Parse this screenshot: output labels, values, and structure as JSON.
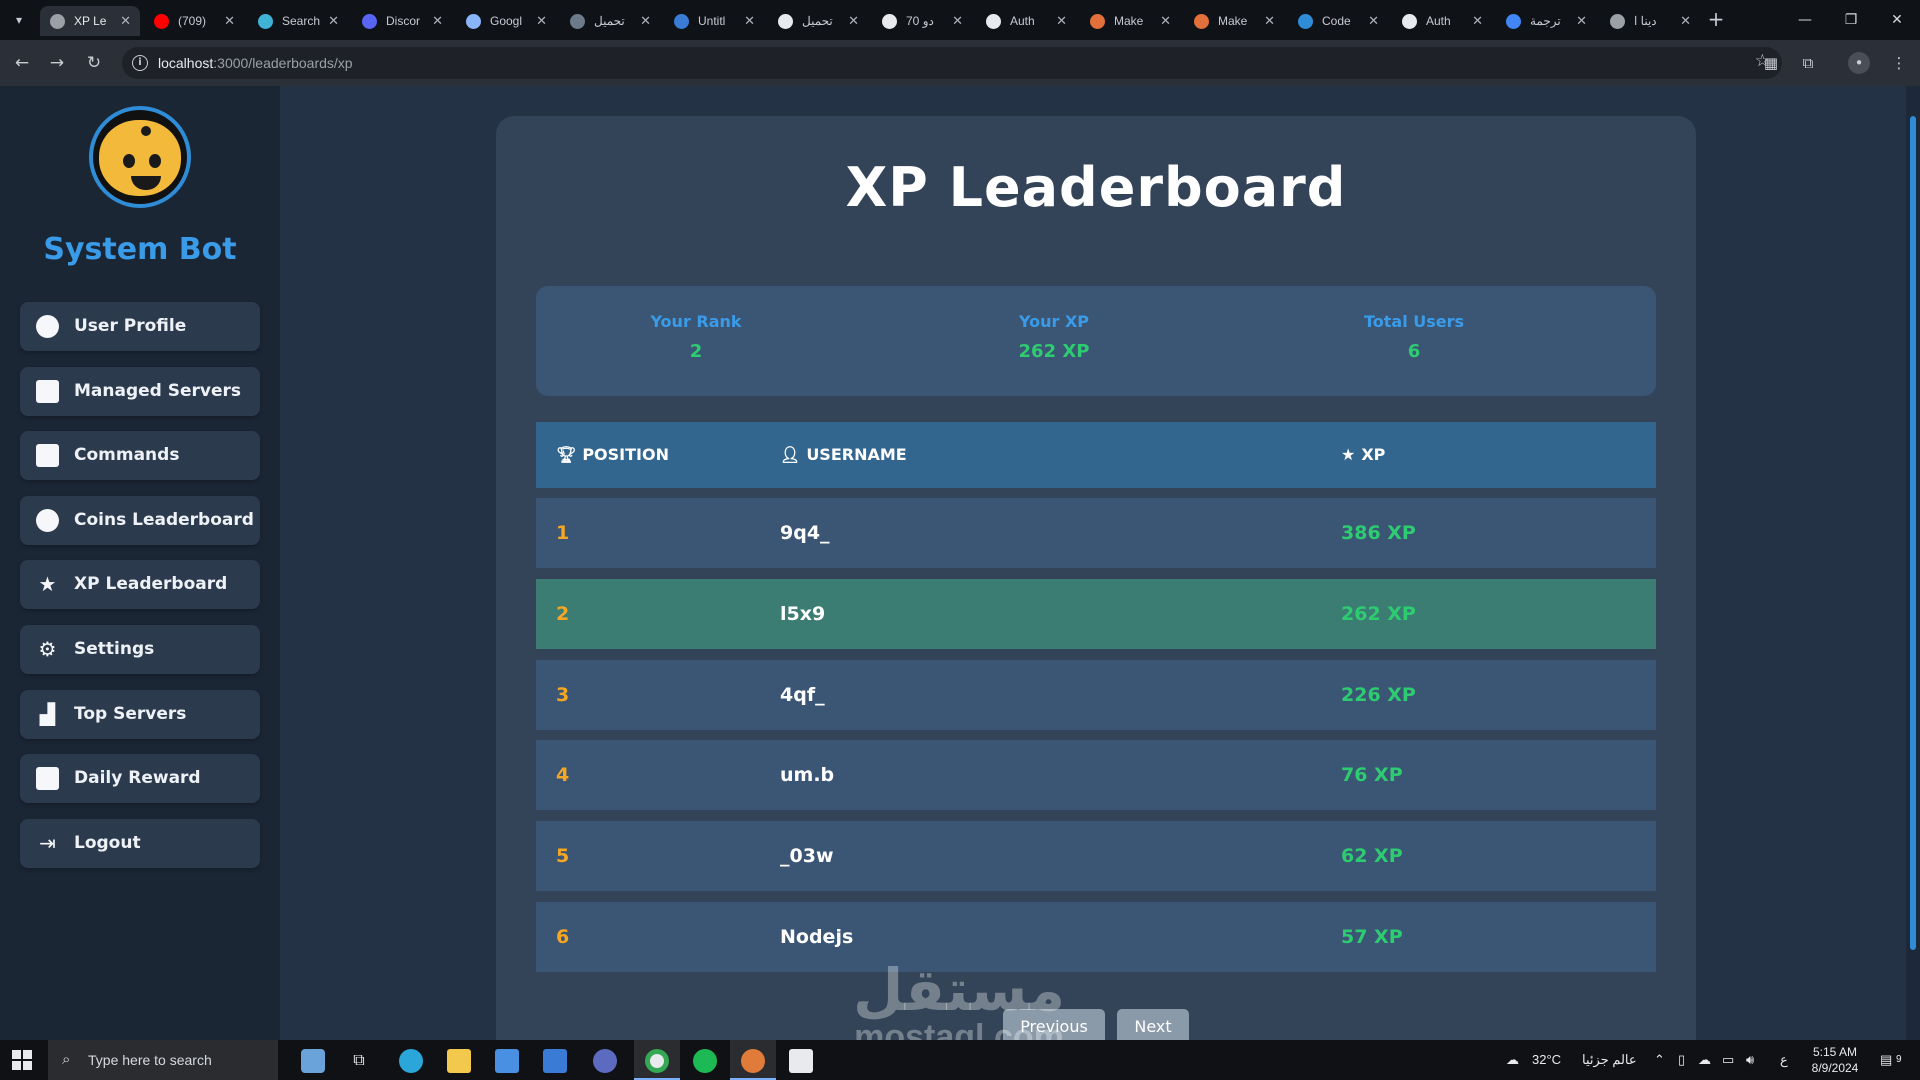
{
  "browser": {
    "tabs": [
      {
        "title": "XP Le",
        "fav": "#9aa0a6"
      },
      {
        "title": "(709)",
        "fav": "#ff0000"
      },
      {
        "title": "Search",
        "fav": "#3fb2d6"
      },
      {
        "title": "Discor",
        "fav": "#5865f2"
      },
      {
        "title": "Googl",
        "fav": "#8ab4f8"
      },
      {
        "title": "تحميل",
        "fav": "#6c7a89"
      },
      {
        "title": "Untitl",
        "fav": "#3a7bd5"
      },
      {
        "title": "تحميل",
        "fav": "#e8eaed"
      },
      {
        "title": "70 دو",
        "fav": "#e8eaed"
      },
      {
        "title": "Auth",
        "fav": "#e8eaed"
      },
      {
        "title": "Make",
        "fav": "#e2703a"
      },
      {
        "title": "Make",
        "fav": "#e2703a"
      },
      {
        "title": "Code",
        "fav": "#2f8cd6"
      },
      {
        "title": "Auth",
        "fav": "#e8eaed"
      },
      {
        "title": "ترجمة",
        "fav": "#4285f4"
      },
      {
        "title": "دينا ا",
        "fav": "#9aa0a6"
      }
    ],
    "url_host": "localhost",
    "url_rest": ":3000/leaderboards/xp"
  },
  "sidebar": {
    "brand": "System Bot",
    "items": [
      {
        "label": "User Profile",
        "icon": "user-icon",
        "glyph": "",
        "shape": "circle"
      },
      {
        "label": "Managed Servers",
        "icon": "server-icon",
        "glyph": "",
        "shape": "square"
      },
      {
        "label": "Commands",
        "icon": "terminal-icon",
        "glyph": "",
        "shape": "square"
      },
      {
        "label": "Coins Leaderboard",
        "icon": "coins-icon",
        "glyph": "",
        "shape": "circle"
      },
      {
        "label": "XP Leaderboard",
        "icon": "star-icon",
        "glyph": "★",
        "shape": ""
      },
      {
        "label": "Settings",
        "icon": "gear-icon",
        "glyph": "⚙",
        "shape": ""
      },
      {
        "label": "Top Servers",
        "icon": "chart-icon",
        "glyph": "▟",
        "shape": ""
      },
      {
        "label": "Daily Reward",
        "icon": "gift-icon",
        "glyph": "",
        "shape": "square"
      },
      {
        "label": "Logout",
        "icon": "logout-icon",
        "glyph": "⇥",
        "shape": ""
      }
    ]
  },
  "main": {
    "title": "XP Leaderboard",
    "stats": [
      {
        "label": "Your Rank",
        "value": "2"
      },
      {
        "label": "Your XP",
        "value": "262 XP"
      },
      {
        "label": "Total Users",
        "value": "6"
      }
    ],
    "columns": {
      "position": "POSITION",
      "username": "USERNAME",
      "xp": "XP"
    },
    "rows": [
      {
        "position": "1",
        "username": "9q4_",
        "xp": "386 XP",
        "me": false
      },
      {
        "position": "2",
        "username": "l5x9",
        "xp": "262 XP",
        "me": true
      },
      {
        "position": "3",
        "username": "4qf_",
        "xp": "226 XP",
        "me": false
      },
      {
        "position": "4",
        "username": "um.b",
        "xp": "76 XP",
        "me": false
      },
      {
        "position": "5",
        "username": "_03w",
        "xp": "62 XP",
        "me": false
      },
      {
        "position": "6",
        "username": "Nodejs",
        "xp": "57 XP",
        "me": false
      }
    ],
    "pager": {
      "previous": "Previous",
      "next": "Next"
    },
    "watermark": {
      "arabic": "مستقل",
      "latin": "mostaql.com"
    }
  },
  "taskbar": {
    "search_placeholder": "Type here to search",
    "weather": "32°C",
    "weather_text": "عالم جزئيا",
    "lang": "ع",
    "time": "5:15 AM",
    "date": "8/9/2024",
    "notifications": "9"
  },
  "colors": {
    "accent": "#3a9be8",
    "xp_green": "#2ecc71",
    "rank_orange": "#f5a623",
    "highlight_row": "#3b7d73"
  }
}
